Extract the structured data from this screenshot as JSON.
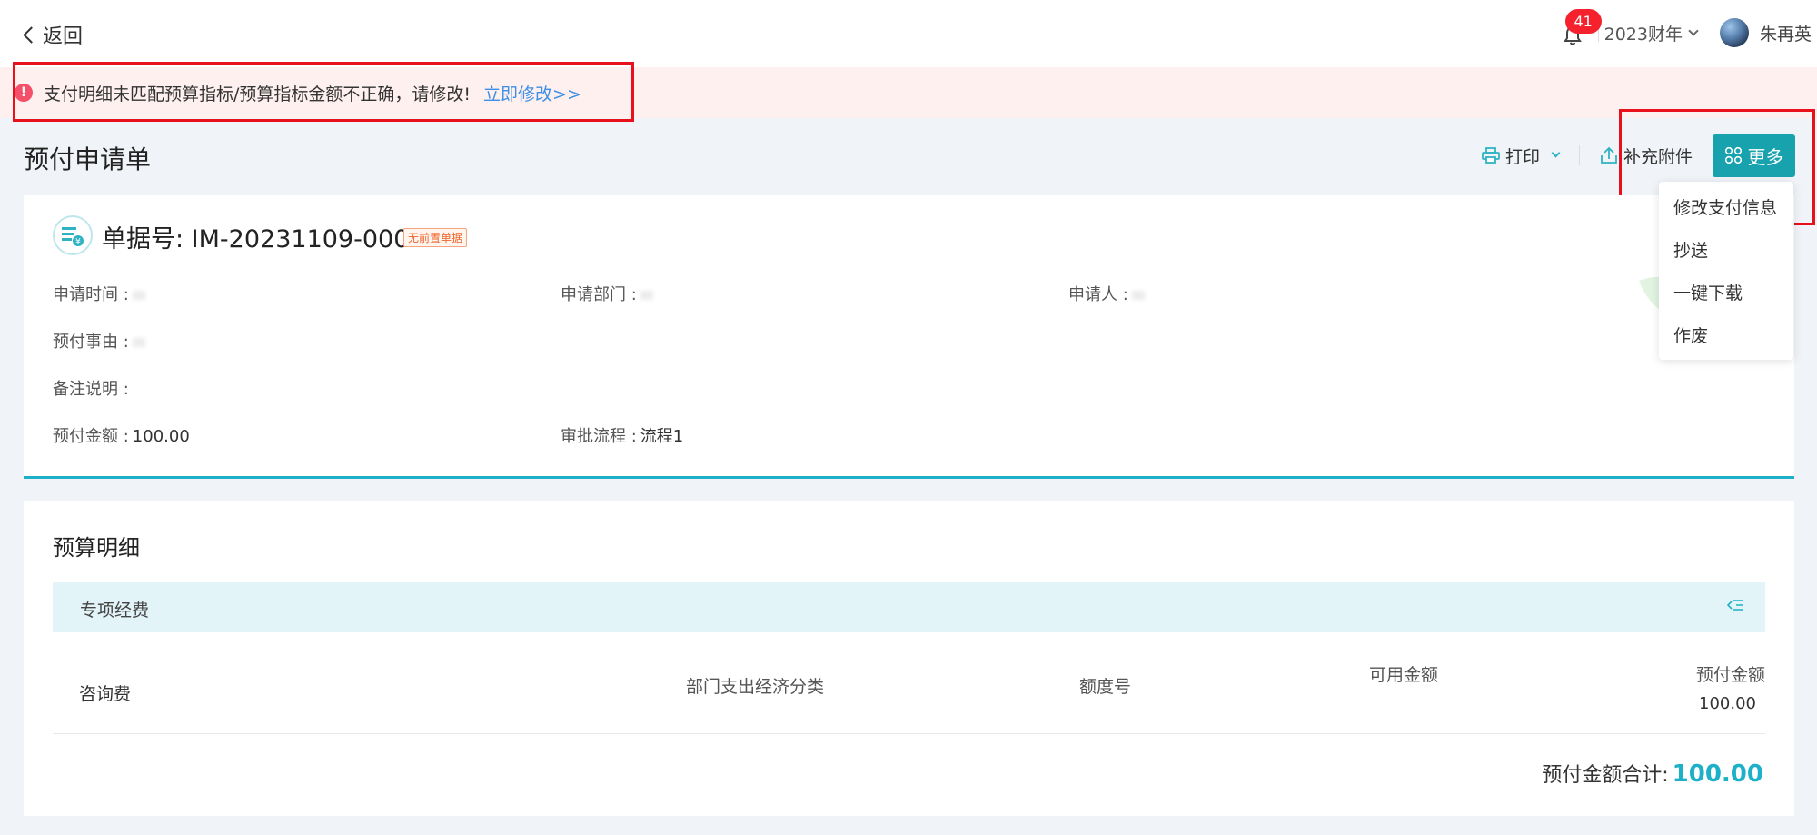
{
  "topbar": {
    "back_label": "返回",
    "notification_count": "41",
    "fiscal_year": "2023财年",
    "user_name": "朱再英"
  },
  "alert": {
    "message": "支付明细未匹配预算指标/预算指标金额不正确，请修改!",
    "link": "立即修改>>"
  },
  "page": {
    "title": "预付申请单",
    "actions": {
      "print": "打印",
      "attach": "补充附件",
      "more": "更多"
    },
    "more_menu": [
      "修改支付信息",
      "抄送",
      "一键下载",
      "作废"
    ]
  },
  "document": {
    "number_label": "单据号: IM-20231109-0001",
    "tag": "无前置单据",
    "fields": {
      "apply_time_label": "申请时间 :",
      "apply_dept_label": "申请部门 :",
      "applicant_label": "申请人 :",
      "reason_label": "预付事由 :",
      "remark_label": "备注说明 :",
      "amount_label": "预付金额 :",
      "amount_value": "100.00",
      "flow_label": "审批流程 :",
      "flow_value": "流程1"
    }
  },
  "budget": {
    "title": "预算明细",
    "group": "专项经费",
    "columns": {
      "econ_class": "部门支出经济分类",
      "quota_no": "额度号",
      "available": "可用金额",
      "prepay": "预付金额"
    },
    "rows": [
      {
        "name": "咨询费",
        "prepay": "100.00"
      }
    ],
    "total_label": "预付金额合计:",
    "total_value": "100.00"
  },
  "colors": {
    "accent": "#17a2ad",
    "highlight_border": "#e8101a",
    "alert_bg": "#fff0f0",
    "link": "#3d8fe6"
  }
}
